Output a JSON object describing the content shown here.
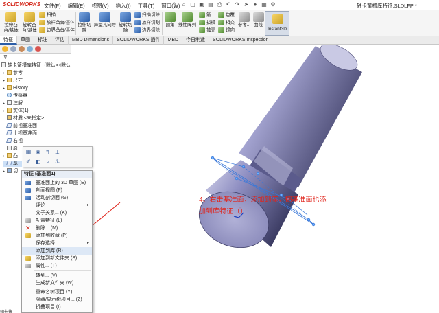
{
  "app": {
    "logo": "SOLIDWORKS",
    "document_title": "轴卡簧槽库特征.SLDLFP *"
  },
  "menu": [
    "文件(F)",
    "编辑(E)",
    "视图(V)",
    "插入(I)",
    "工具(T)",
    "窗口(W)"
  ],
  "ribbon": {
    "extrude_boss": "拉伸凸台/基体",
    "revolve_boss": "旋转凸台/基体",
    "sweep": "扫描",
    "loft_boss": "放样凸台/基体",
    "boundary_boss": "边界凸台/基体",
    "extrude_cut": "拉伸切除",
    "hole_wizard": "异型孔向导",
    "revolve_cut": "旋转切除",
    "swept_cut": "扫描切除",
    "lofted_cut": "放样切割",
    "boundary_cut": "边界切除",
    "fillet": "圆角",
    "linear_pattern": "线性阵列",
    "rib": "筋",
    "draft": "拔模",
    "shell": "抽壳",
    "wrap": "包覆",
    "intersect": "相交",
    "mirror": "镜向",
    "reference": "参考...",
    "curves": "曲线",
    "instant3d": "Instant3D"
  },
  "tabs": [
    "特征",
    "草图",
    "标注",
    "评估",
    "MBD Dimensions",
    "SOLIDWORKS 插件",
    "MBD",
    "今日制造",
    "SOLIDWORKS Inspection"
  ],
  "tree": {
    "root": "轴卡簧槽库特征（默认<<默认",
    "items": [
      {
        "label": "参考",
        "indent": 1
      },
      {
        "label": "尺寸",
        "indent": 1
      },
      {
        "label": "History",
        "indent": 1
      },
      {
        "label": "传感器",
        "indent": 1
      },
      {
        "label": "注解",
        "indent": 1
      },
      {
        "label": "实体(1)",
        "indent": 1
      },
      {
        "label": "材质 <未指定>",
        "indent": 1
      },
      {
        "label": "前视基准面",
        "indent": 1
      },
      {
        "label": "上视基准面",
        "indent": 1
      },
      {
        "label": "右视",
        "indent": 1
      },
      {
        "label": "原",
        "indent": 1
      },
      {
        "label": "凸",
        "indent": 1
      },
      {
        "label": "基",
        "indent": 1
      },
      {
        "label": "切",
        "indent": 1
      }
    ]
  },
  "context_menu": {
    "title": "特征 (基准面1)",
    "items": [
      "基准面上的 3D 草图 (E)",
      "剖面视图 (F)",
      "活动剖切面 (G)",
      "评论",
      "父子关系... (K)",
      "配置特征 (L)",
      "删除... (M)",
      "添加到收藏 (P)",
      "保存选择",
      "添加到库 (R)",
      "添加到新文件夹 (S)",
      "属性... (T)",
      "转到... (V)",
      "生成新文件夹 (W)",
      "重命名树项目 (Y)",
      "隐藏/显示树项目... (Z)",
      "折叠项目 (I)"
    ]
  },
  "annotation": "4、右击基准面，添加到库，把基准面也添加到库特征（）",
  "colors": {
    "accent": "#2c5ea8",
    "annotation": "#e0241b",
    "part_face": "#9a9ac8",
    "part_dark": "#3d3d66"
  },
  "bottom": "轴卡簧"
}
